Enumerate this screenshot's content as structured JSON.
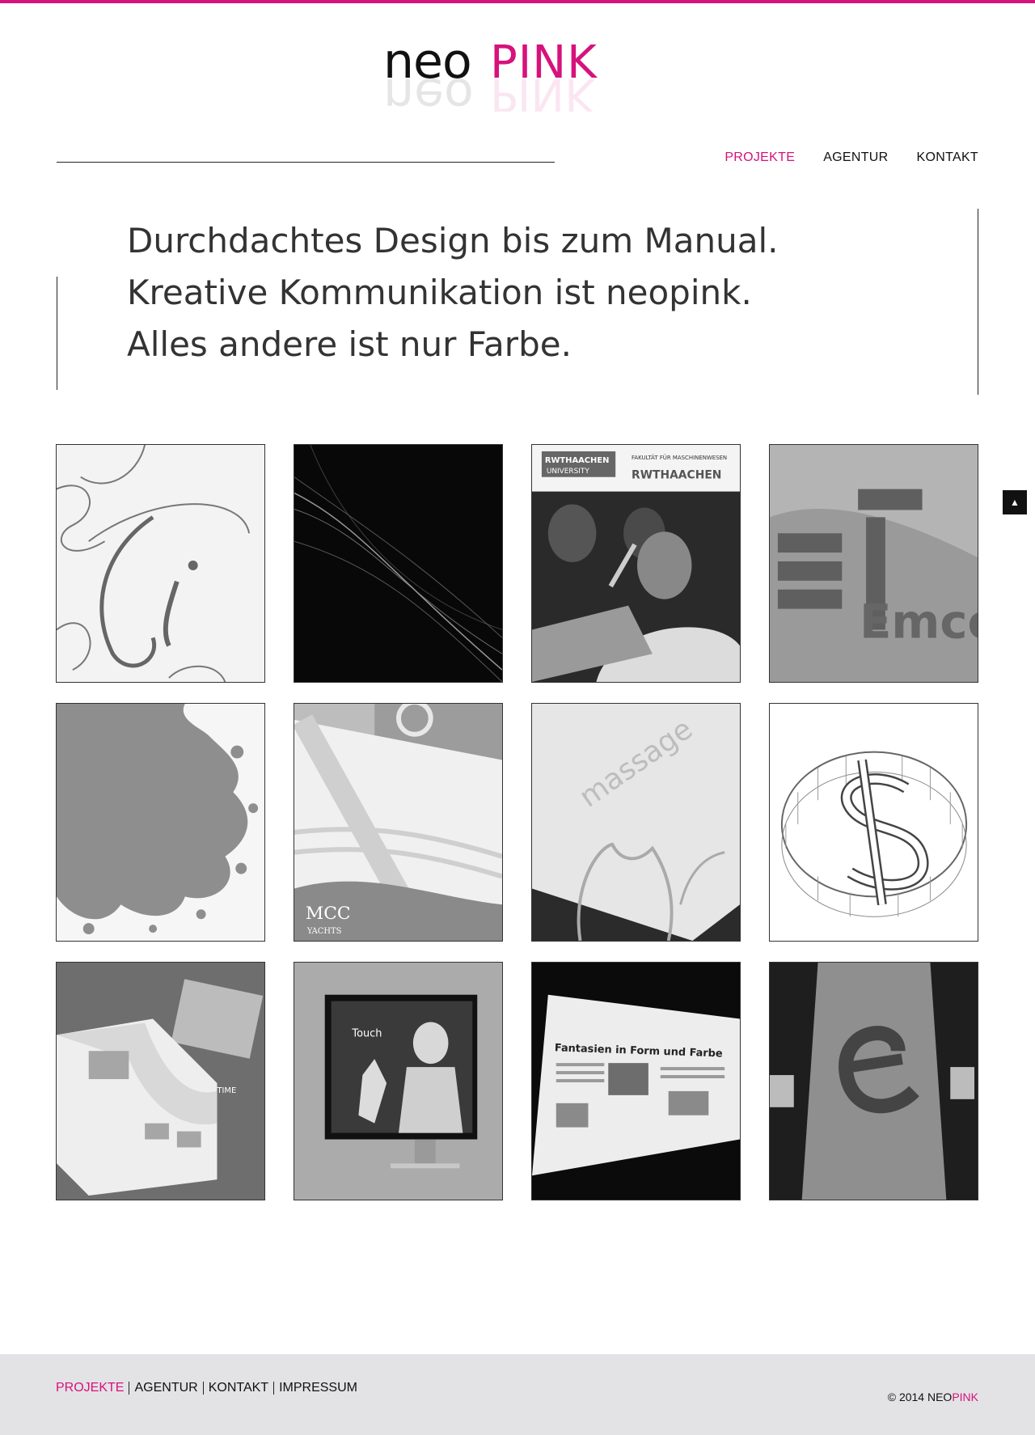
{
  "brand": {
    "logo_neo": "neo",
    "logo_pink": "PINK",
    "accent": "#d6127c"
  },
  "nav": [
    {
      "label": "PROJEKTE",
      "active": true
    },
    {
      "label": "AGENTUR",
      "active": false
    },
    {
      "label": "KONTAKT",
      "active": false
    }
  ],
  "quote": {
    "line1": "Durchdachtes Design bis zum Manual.",
    "line2": "Kreative Kommunikation ist neopink.",
    "line3": "Alles andere ist nur Farbe."
  },
  "tiles": {
    "t3": {
      "logo_left": "RWTHAACHEN",
      "logo_left_sub": "UNIVERSITY",
      "faculty": "FAKULTÄT FÜR\nMASCHINENWESEN",
      "logo_right": "RWTHAACHEN"
    },
    "t4": {
      "brand": "Emco"
    },
    "t6": {
      "brand": "MCC",
      "sub": "YACHTS"
    },
    "t7": {
      "text": "massage"
    },
    "t9": {
      "text": "TIME"
    },
    "t10": {
      "text": "Touch"
    },
    "t11": {
      "headline": "Fantasien in Form und Farbe"
    }
  },
  "back_to_top": {
    "icon": "arrow-up-icon",
    "glyph": "▲"
  },
  "footer": {
    "nav": [
      {
        "label": "PROJEKTE",
        "active": true
      },
      {
        "label": "AGENTUR",
        "active": false
      },
      {
        "label": "KONTAKT",
        "active": false
      },
      {
        "label": "IMPRESSUM",
        "active": false
      }
    ],
    "copyright_prefix": "© 2014 NEO",
    "copyright_pink": "PINK"
  }
}
